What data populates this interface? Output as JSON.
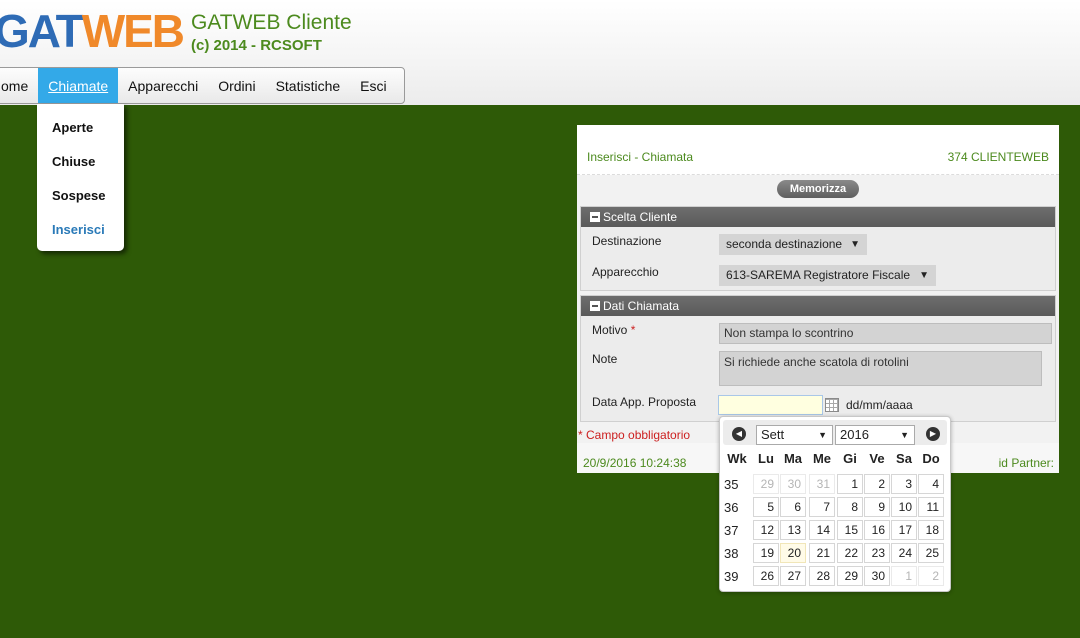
{
  "header": {
    "logo_part1": "GAT",
    "logo_part2": "WEB",
    "title": "GATWEB Cliente",
    "subtitle": "(c) 2014 - RCSOFT"
  },
  "menu": {
    "items": [
      "ome",
      "Chiamate",
      "Apparecchi",
      "Ordini",
      "Statistiche",
      "Esci"
    ],
    "active": "Chiamate"
  },
  "submenu": {
    "items": [
      "Aperte",
      "Chiuse",
      "Sospese",
      "Inserisci"
    ],
    "current": "Inserisci"
  },
  "panel": {
    "title": "Inserisci - Chiamata",
    "user": "374 CLIENTEWEB",
    "save_label": "Memorizza",
    "section1": {
      "title": "Scelta Cliente",
      "destinazione_label": "Destinazione",
      "destinazione_value": "seconda destinazione",
      "apparecchio_label": "Apparecchio",
      "apparecchio_value": "613-SAREMA Registratore Fiscale"
    },
    "section2": {
      "title": "Dati Chiamata",
      "motivo_label": "Motivo",
      "required_mark": "*",
      "motivo_value": "Non stampa lo scontrino",
      "note_label": "Note",
      "note_value": "Si richiede anche scatola di rotolini",
      "data_label": "Data App. Proposta",
      "data_value": "",
      "data_format": "dd/mm/aaaa"
    },
    "required_note": "* Campo obbligatorio",
    "timestamp": "20/9/2016 10:24:38",
    "partner_label": "id Partner:"
  },
  "calendar": {
    "month": "Sett",
    "year": "2016",
    "weekday_headers": [
      "Wk",
      "Lu",
      "Ma",
      "Me",
      "Gi",
      "Ve",
      "Sa",
      "Do"
    ],
    "today": "20",
    "weeks": [
      {
        "wk": "35",
        "days": [
          "29",
          "30",
          "31",
          "1",
          "2",
          "3",
          "4"
        ],
        "other": [
          true,
          true,
          true,
          false,
          false,
          false,
          false
        ]
      },
      {
        "wk": "36",
        "days": [
          "5",
          "6",
          "7",
          "8",
          "9",
          "10",
          "11"
        ],
        "other": [
          false,
          false,
          false,
          false,
          false,
          false,
          false
        ]
      },
      {
        "wk": "37",
        "days": [
          "12",
          "13",
          "14",
          "15",
          "16",
          "17",
          "18"
        ],
        "other": [
          false,
          false,
          false,
          false,
          false,
          false,
          false
        ]
      },
      {
        "wk": "38",
        "days": [
          "19",
          "20",
          "21",
          "22",
          "23",
          "24",
          "25"
        ],
        "other": [
          false,
          false,
          false,
          false,
          false,
          false,
          false
        ]
      },
      {
        "wk": "39",
        "days": [
          "26",
          "27",
          "28",
          "29",
          "30",
          "1",
          "2"
        ],
        "other": [
          false,
          false,
          false,
          false,
          false,
          true,
          true
        ]
      }
    ],
    "icons": {
      "prev": "chevron-left-icon",
      "next": "chevron-right-icon"
    }
  }
}
